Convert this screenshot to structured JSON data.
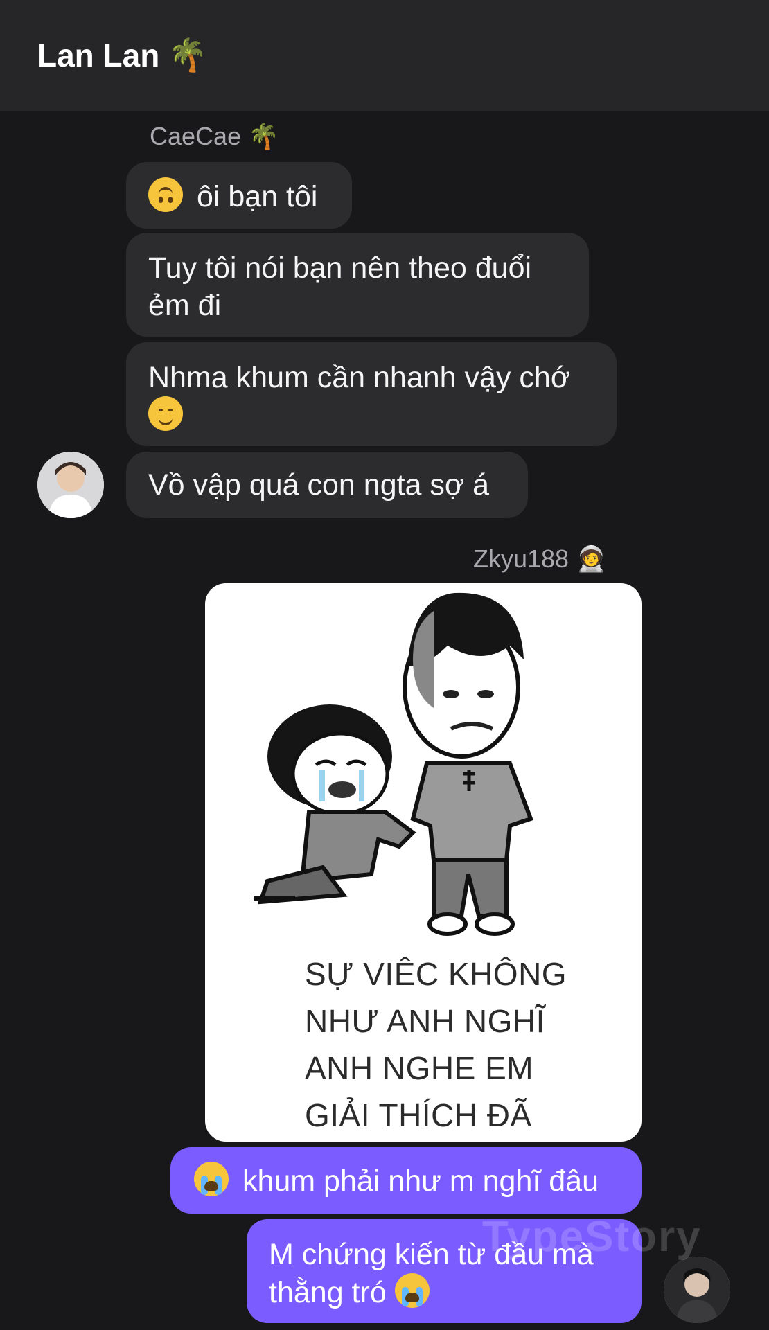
{
  "header": {
    "title": "Lan Lan",
    "title_emoji": "🌴"
  },
  "incoming": {
    "sender_name": "CaeCae",
    "sender_emoji": "🌴",
    "messages": [
      {
        "emoji": "upside-down-face-icon",
        "text": "ôi bạn tôi"
      },
      {
        "text": "Tuy tôi nói bạn nên theo đuổi ẻm đi"
      },
      {
        "text": "Nhma khum cần nhanh vậy chớ",
        "emoji": "smiling-face-icon"
      },
      {
        "text": "Vồ vập quá con ngta sợ á"
      }
    ]
  },
  "outgoing": {
    "sender_name": "Zkyu188",
    "sender_emoji": "🧑‍🚀",
    "image_caption_lines": [
      "SỰ VIÊC KHÔNG",
      "NHƯ ANH NGHĨ",
      "ANH NGHE EM",
      "GIẢI THÍCH ĐÃ"
    ],
    "messages": [
      {
        "emoji": "loudly-crying-face-icon",
        "text": "khum phải như m nghĩ đâu"
      },
      {
        "text": "M chứng kiến từ đầu mà thằng tró",
        "emoji": "loudly-crying-face-icon"
      }
    ]
  },
  "watermark": "TypeStory",
  "colors": {
    "background": "#18181a",
    "header": "#262628",
    "incoming_bubble": "#2c2c2f",
    "outgoing_bubble": "#7b5cff"
  }
}
